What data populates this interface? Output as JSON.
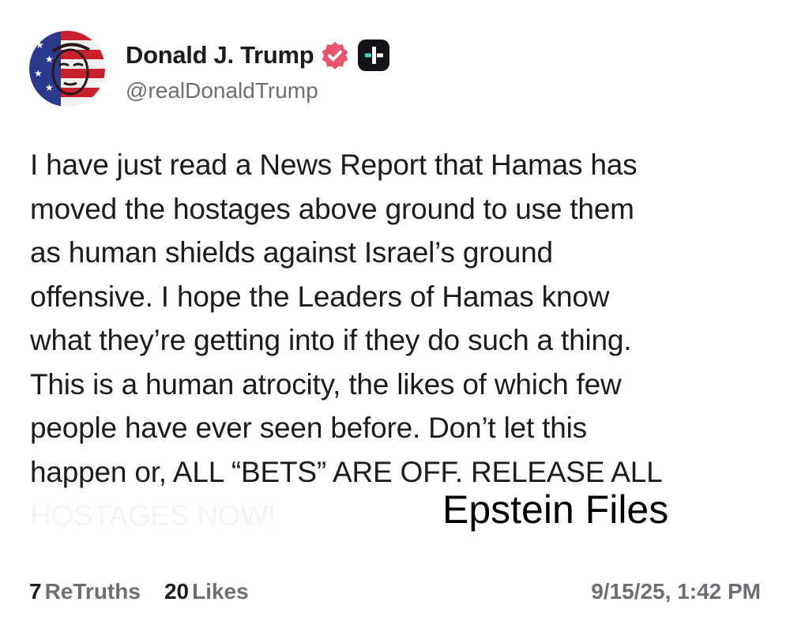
{
  "author": {
    "display_name": "Donald J. Trump",
    "handle": "@realDonaldTrump",
    "verified_badge_icon": "verified-check-icon",
    "verified_badge_color": "#e8546e",
    "plus_badge_icon": "plus-badge-icon",
    "plus_badge_color": "#141418",
    "avatar_icon": "profile-avatar"
  },
  "post": {
    "lines": [
      "I have just read a News Report that Hamas has",
      "moved the hostages above ground to use them",
      "as human shields against Israel’s ground",
      "offensive. I hope the Leaders of Hamas know",
      "what they’re getting into if they do such a thing.",
      "This is a human atrocity, the likes of which few",
      "people have ever seen before. Don’t let this",
      "happen or, ALL “BETS” ARE OFF. RELEASE ALL",
      "HOSTAGES NOW!"
    ],
    "overlay_caption": "Epstein Files"
  },
  "footer": {
    "retruths_count": "7",
    "retruths_label": "ReTruths",
    "likes_count": "20",
    "likes_label": "Likes",
    "timestamp": "9/15/25, 1:42 PM"
  },
  "colors": {
    "text_primary": "#1c1c1e",
    "text_secondary": "#6e6e78",
    "background": "#ffffff"
  }
}
